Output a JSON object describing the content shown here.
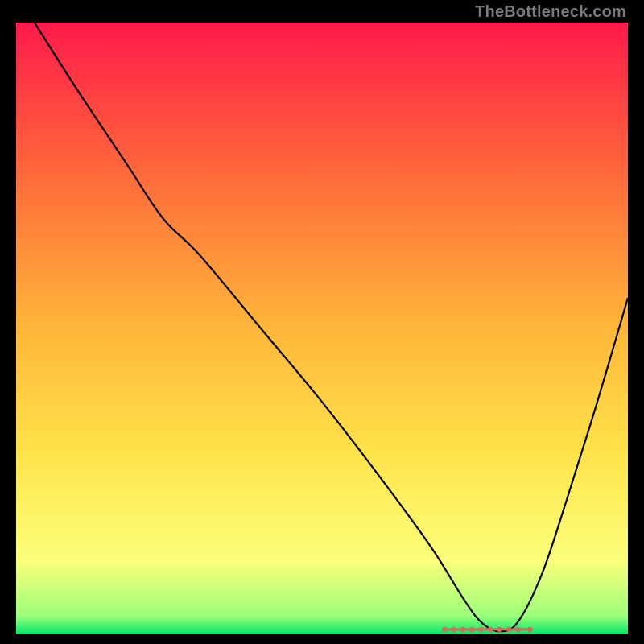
{
  "watermark": "TheBottleneck.com",
  "chart_data": {
    "type": "line",
    "title": "",
    "xlabel": "",
    "ylabel": "",
    "xlim": [
      0,
      100
    ],
    "ylim": [
      0,
      100
    ],
    "grid": false,
    "legend": false,
    "background_gradient": {
      "stops": [
        {
          "offset": 0.0,
          "color": "#ff1a4b"
        },
        {
          "offset": 0.25,
          "color": "#ff6a3a"
        },
        {
          "offset": 0.5,
          "color": "#ffb63a"
        },
        {
          "offset": 0.7,
          "color": "#ffe24a"
        },
        {
          "offset": 0.88,
          "color": "#fbff7a"
        },
        {
          "offset": 0.97,
          "color": "#9cff7a"
        },
        {
          "offset": 1.0,
          "color": "#00e66a"
        }
      ]
    },
    "series": [
      {
        "name": "bottleneck-curve",
        "type": "line",
        "color": "#000000",
        "x": [
          3,
          10,
          18,
          24,
          30,
          40,
          50,
          60,
          68,
          73,
          76,
          79,
          82,
          86,
          90,
          95,
          100
        ],
        "y": [
          100,
          89,
          77,
          68,
          62,
          50,
          38,
          25,
          14,
          6,
          2,
          0.5,
          2,
          10,
          22,
          38,
          55
        ]
      },
      {
        "name": "optimal-markers",
        "type": "scatter",
        "color": "#d66a5a",
        "x": [
          70,
          71.5,
          73,
          74.5,
          76,
          77.5,
          79,
          80.5,
          82,
          84
        ],
        "y": [
          0.8,
          0.8,
          0.8,
          0.8,
          0.8,
          0.8,
          0.8,
          0.8,
          0.8,
          0.8
        ]
      }
    ],
    "annotations": []
  }
}
